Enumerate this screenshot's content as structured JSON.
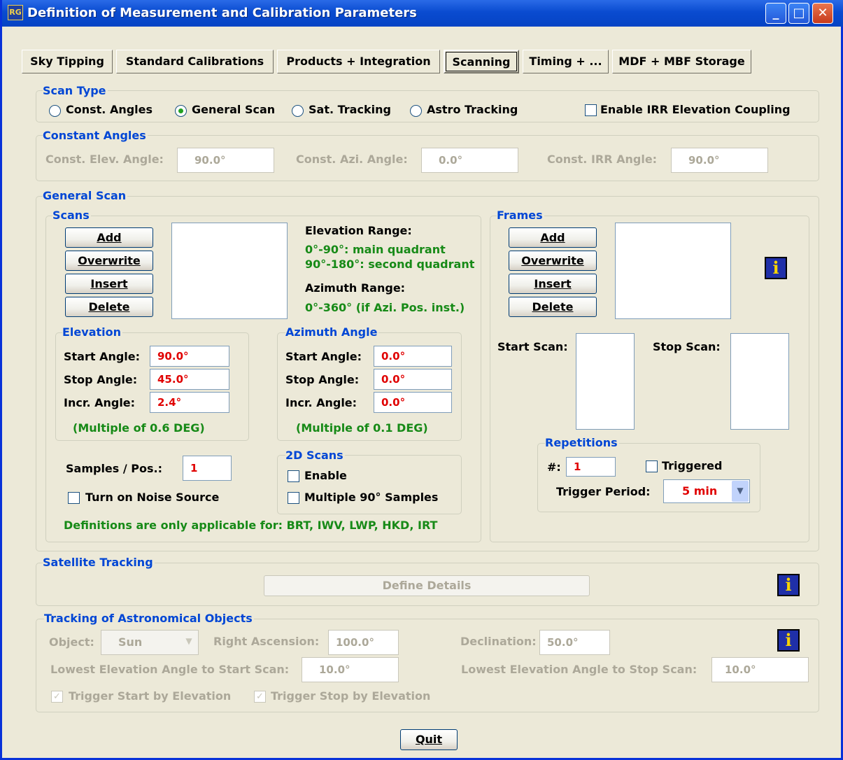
{
  "window": {
    "title": "Definition of Measurement and Calibration Parameters"
  },
  "tabs": [
    "Sky Tipping",
    "Standard Calibrations",
    "Products + Integration",
    "Scanning",
    "Timing + ...",
    "MDF + MBF Storage"
  ],
  "scan_type": {
    "legend": "Scan Type",
    "options": [
      "Const. Angles",
      "General Scan",
      "Sat. Tracking",
      "Astro Tracking"
    ],
    "selected": "General Scan",
    "coupling_label": "Enable IRR Elevation Coupling"
  },
  "constant_angles": {
    "legend": "Constant Angles",
    "elev_label": "Const. Elev. Angle:",
    "elev_value": "90.0°",
    "azi_label": "Const. Azi. Angle:",
    "azi_value": "0.0°",
    "irr_label": "Const. IRR Angle:",
    "irr_value": "90.0°"
  },
  "general_scan": {
    "legend": "General Scan",
    "scans": {
      "legend": "Scans",
      "buttons": [
        "Add",
        "Overwrite",
        "Insert",
        "Delete"
      ],
      "elev_range_label": "Elevation Range:",
      "elev_range_line1": "0°-90°: main quadrant",
      "elev_range_line2": "90°-180°: second quadrant",
      "azi_range_label": "Azimuth Range:",
      "azi_range_text": "0°-360° (if Azi. Pos. inst.)"
    },
    "elevation": {
      "legend": "Elevation",
      "start_label": "Start Angle:",
      "start_value": "90.0°",
      "stop_label": "Stop Angle:",
      "stop_value": "45.0°",
      "incr_label": "Incr. Angle:",
      "incr_value": "2.4°",
      "note": "(Multiple of 0.6 DEG)"
    },
    "azimuth": {
      "legend": "Azimuth Angle",
      "start_label": "Start Angle:",
      "start_value": "0.0°",
      "stop_label": "Stop Angle:",
      "stop_value": "0.0°",
      "incr_label": "Incr. Angle:",
      "incr_value": "0.0°",
      "note": "(Multiple of 0.1 DEG)"
    },
    "samples_label": "Samples / Pos.:",
    "samples_value": "1",
    "noise_label": "Turn on Noise Source",
    "scans_2d": {
      "legend": "2D Scans",
      "enable_label": "Enable",
      "multiple_label": "Multiple 90° Samples"
    },
    "footnote": "Definitions are only applicable for: BRT, IWV, LWP, HKD, IRT",
    "frames": {
      "legend": "Frames",
      "buttons": [
        "Add",
        "Overwrite",
        "Insert",
        "Delete"
      ],
      "start_scan_label": "Start Scan:",
      "stop_scan_label": "Stop Scan:",
      "repetitions": {
        "legend": "Repetitions",
        "hash_label": "#:",
        "hash_value": "1",
        "triggered_label": "Triggered",
        "trigger_period_label": "Trigger Period:",
        "trigger_period_value": "5 min"
      }
    }
  },
  "satellite_tracking": {
    "legend": "Satellite Tracking",
    "button": "Define Details"
  },
  "astro": {
    "legend": "Tracking of Astronomical Objects",
    "object_label": "Object:",
    "object_value": "Sun",
    "ra_label": "Right Ascension:",
    "ra_value": "100.0°",
    "dec_label": "Declination:",
    "dec_value": "50.0°",
    "low_start_label": "Lowest Elevation Angle to Start Scan:",
    "low_start_value": "10.0°",
    "low_stop_label": "Lowest Elevation Angle to Stop Scan:",
    "low_stop_value": "10.0°",
    "trigger_start_label": "Trigger Start by Elevation",
    "trigger_stop_label": "Trigger Stop by Elevation"
  },
  "quit_label": "Quit",
  "colors": {
    "titlebar": "#0A4BD0",
    "legend": "#0046D5",
    "green_text": "#178A17",
    "red_value": "#E00000"
  }
}
